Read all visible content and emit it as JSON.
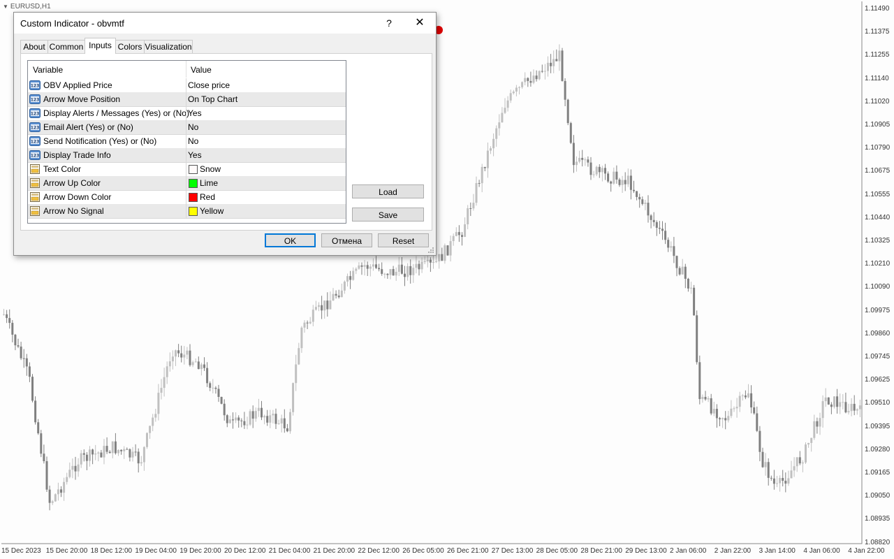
{
  "chart": {
    "symbol": "EURUSD,H1",
    "price_axis": [
      "1.11490",
      "1.11375",
      "1.11255",
      "1.11140",
      "1.11020",
      "1.10905",
      "1.10790",
      "1.10675",
      "1.10555",
      "1.10440",
      "1.10325",
      "1.10210",
      "1.10090",
      "1.09975",
      "1.09860",
      "1.09745",
      "1.09625",
      "1.09510",
      "1.09395",
      "1.09280",
      "1.09165",
      "1.09050",
      "1.08935",
      "1.08820"
    ],
    "time_axis": [
      "15 Dec 2023",
      "15 Dec 20:00",
      "18 Dec 12:00",
      "19 Dec 04:00",
      "19 Dec 20:00",
      "20 Dec 12:00",
      "21 Dec 04:00",
      "21 Dec 20:00",
      "22 Dec 12:00",
      "26 Dec 05:00",
      "26 Dec 21:00",
      "27 Dec 13:00",
      "28 Dec 05:00",
      "28 Dec 21:00",
      "29 Dec 13:00",
      "2 Jan 06:00",
      "2 Jan 22:00",
      "3 Jan 14:00",
      "4 Jan 06:00",
      "4 Jan 22:00"
    ],
    "arrow_color": "#e00000",
    "bull_color": "#c0c0c0",
    "bear_color": "#808080"
  },
  "dialog": {
    "title": "Custom Indicator - obvmtf",
    "help": "?",
    "close": "✕",
    "tabs": [
      "About",
      "Common",
      "Inputs",
      "Colors",
      "Visualization"
    ],
    "active_tab": "Inputs",
    "columns": {
      "variable": "Variable",
      "value": "Value"
    },
    "inputs": [
      {
        "name": "OBV Applied Price",
        "value": "Close price",
        "icon": "numeric-icon"
      },
      {
        "name": "Arrow Move Position",
        "value": "On Top Chart",
        "icon": "numeric-icon"
      },
      {
        "name": "Display Alerts / Messages (Yes) or (No)",
        "value": "Yes",
        "icon": "numeric-icon"
      },
      {
        "name": "Email Alert (Yes) or (No)",
        "value": "No",
        "icon": "numeric-icon"
      },
      {
        "name": "Send Notification (Yes) or (No)",
        "value": "No",
        "icon": "numeric-icon"
      },
      {
        "name": "Display Trade Info",
        "value": "Yes",
        "icon": "numeric-icon"
      },
      {
        "name": "Text Color",
        "value": "Snow",
        "icon": "color-icon",
        "swatch": "#fffafa"
      },
      {
        "name": "Arrow Up Color",
        "value": "Lime",
        "icon": "color-icon",
        "swatch": "#00ff00"
      },
      {
        "name": "Arrow Down Color",
        "value": "Red",
        "icon": "color-icon",
        "swatch": "#ff0000"
      },
      {
        "name": "Arrow No Signal",
        "value": "Yellow",
        "icon": "color-icon",
        "swatch": "#ffff00"
      }
    ],
    "buttons": {
      "load": "Load",
      "save": "Save",
      "ok": "OK",
      "cancel": "Отмена",
      "reset": "Reset"
    }
  }
}
